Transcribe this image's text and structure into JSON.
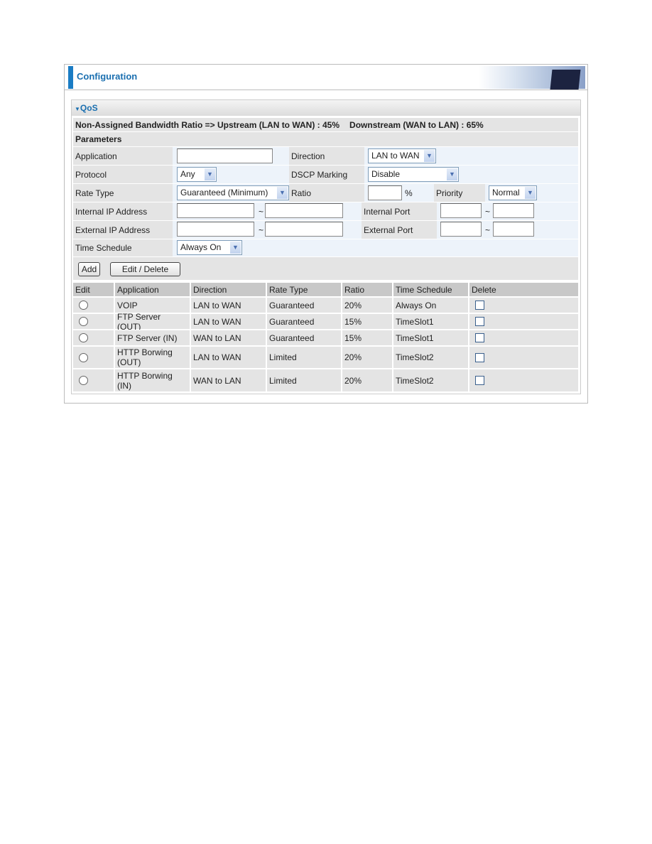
{
  "header": {
    "title": "Configuration"
  },
  "section": {
    "title": "QoS"
  },
  "bandwidth": {
    "text": "Non-Assigned Bandwidth Ratio => Upstream (LAN to WAN) : 45%",
    "downstream": "Downstream (WAN to LAN) : 65%"
  },
  "parameters_title": "Parameters",
  "form": {
    "application": {
      "label": "Application",
      "value": ""
    },
    "direction": {
      "label": "Direction",
      "value": "LAN to WAN"
    },
    "protocol": {
      "label": "Protocol",
      "value": "Any"
    },
    "dscp": {
      "label": "DSCP Marking",
      "value": "Disable"
    },
    "rate_type": {
      "label": "Rate Type",
      "value": "Guaranteed (Minimum)"
    },
    "ratio": {
      "label": "Ratio",
      "value": "",
      "unit": "%"
    },
    "priority": {
      "label": "Priority",
      "value": "Normal"
    },
    "internal_ip": {
      "label": "Internal IP Address",
      "from": "",
      "to": "",
      "sep": "~"
    },
    "internal_port": {
      "label": "Internal Port",
      "from": "",
      "to": "",
      "sep": "~"
    },
    "external_ip": {
      "label": "External IP Address",
      "from": "",
      "to": "",
      "sep": "~"
    },
    "external_port": {
      "label": "External Port",
      "from": "",
      "to": "",
      "sep": "~"
    },
    "time_schedule": {
      "label": "Time Schedule",
      "value": "Always On"
    }
  },
  "buttons": {
    "add": "Add",
    "edit_delete": "Edit / Delete"
  },
  "table": {
    "headers": [
      "Edit",
      "Application",
      "Direction",
      "Rate Type",
      "Ratio",
      "Time Schedule",
      "Delete"
    ],
    "rows": [
      {
        "application": "VOIP",
        "direction": "LAN to WAN",
        "rate_type": "Guaranteed",
        "ratio": "20%",
        "schedule": "Always On"
      },
      {
        "application": "FTP Server (OUT)",
        "direction": "LAN to WAN",
        "rate_type": "Guaranteed",
        "ratio": "15%",
        "schedule": "TimeSlot1"
      },
      {
        "application": "FTP Server (IN)",
        "direction": "WAN to LAN",
        "rate_type": "Guaranteed",
        "ratio": "15%",
        "schedule": "TimeSlot1"
      },
      {
        "application": "HTTP Borwing (OUT)",
        "direction": "LAN to WAN",
        "rate_type": "Limited",
        "ratio": "20%",
        "schedule": "TimeSlot2"
      },
      {
        "application": "HTTP Borwing (IN)",
        "direction": "WAN to LAN",
        "rate_type": "Limited",
        "ratio": "20%",
        "schedule": "TimeSlot2"
      }
    ]
  },
  "colors": {
    "accent": "#1a7cc4",
    "title": "#1a6fb0"
  }
}
